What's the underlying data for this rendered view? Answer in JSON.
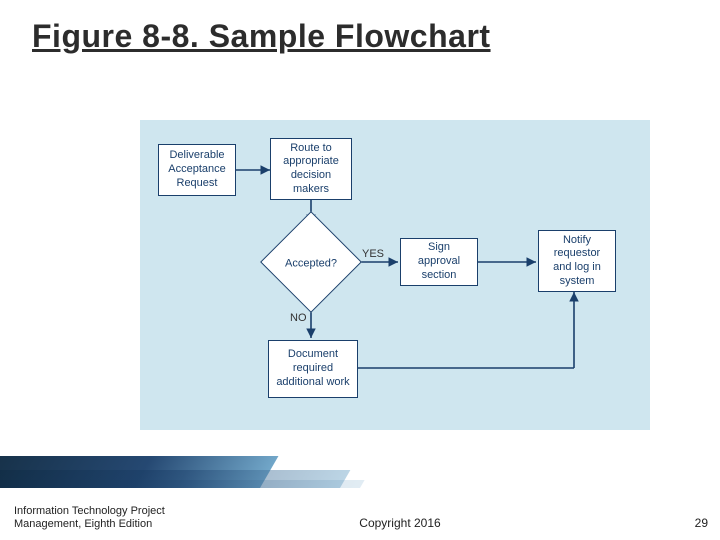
{
  "title": "Figure 8-8. Sample Flowchart",
  "nodes": {
    "start": "Deliverable Acceptance Request",
    "route": "Route to appropriate decision makers",
    "decision": "Accepted?",
    "sign": "Sign approval section",
    "notify": "Notify requestor and log in system",
    "document": "Document required additional work"
  },
  "edge_labels": {
    "yes": "YES",
    "no": "NO"
  },
  "footer": {
    "source_line1": "Information Technology Project",
    "source_line2": "Management, Eighth Edition",
    "copyright": "Copyright 2016",
    "page": "29"
  }
}
